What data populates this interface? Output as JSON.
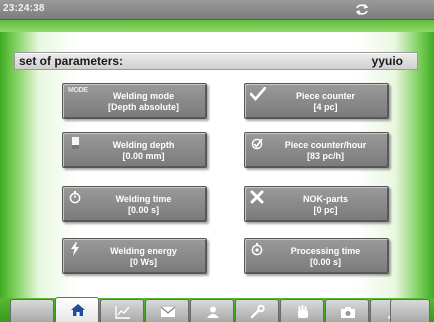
{
  "status_bar": {
    "time": "23:24:38",
    "sync_icon": "sync-icon"
  },
  "parameter_set": {
    "label": "set of parameters:",
    "value": "yyuio"
  },
  "tiles_left": [
    {
      "id": "welding-mode",
      "icon": "mode-icon",
      "icon_text": "MODE",
      "line1": "Welding mode",
      "line2": "[Depth absolute]"
    },
    {
      "id": "welding-depth",
      "icon": "depth-icon",
      "line1": "Welding depth",
      "line2": "[0.00 mm]"
    },
    {
      "id": "welding-time",
      "icon": "stopwatch-icon",
      "line1": "Welding time",
      "line2": "[0.00 s]"
    },
    {
      "id": "welding-energy",
      "icon": "lightning-icon",
      "line1": "Welding energy",
      "line2": "[0 Ws]"
    }
  ],
  "tiles_right": [
    {
      "id": "piece-counter",
      "icon": "checkmark-icon",
      "line1": "Piece counter",
      "line2": "[4 pc]"
    },
    {
      "id": "piece-counter-hour",
      "icon": "check-clock-icon",
      "line1": "Piece counter/hour",
      "line2": "[83 pc/h]"
    },
    {
      "id": "nok-parts",
      "icon": "x-cross-icon",
      "line1": "NOK-parts",
      "line2": "[0 pc]"
    },
    {
      "id": "processing-time",
      "icon": "stopwatch-gear-icon",
      "line1": "Processing time",
      "line2": "[0.00 s]"
    }
  ],
  "nav_tabs": [
    {
      "icon": "blank",
      "active": false
    },
    {
      "icon": "home-icon",
      "active": true
    },
    {
      "icon": "chart-icon",
      "active": false
    },
    {
      "icon": "envelope-icon",
      "active": false
    },
    {
      "icon": "user-icon",
      "active": false
    },
    {
      "icon": "wrench-icon",
      "active": false
    },
    {
      "icon": "hand-icon",
      "active": false
    },
    {
      "icon": "camera-icon",
      "active": false
    },
    {
      "icon": "pen-icon",
      "active": false
    },
    {
      "icon": "blank",
      "active": false
    }
  ],
  "colors": {
    "green_frame": "#5fbe3c",
    "tile_gray": "#8a8a8a",
    "status_bar": "#8c8c8c"
  }
}
